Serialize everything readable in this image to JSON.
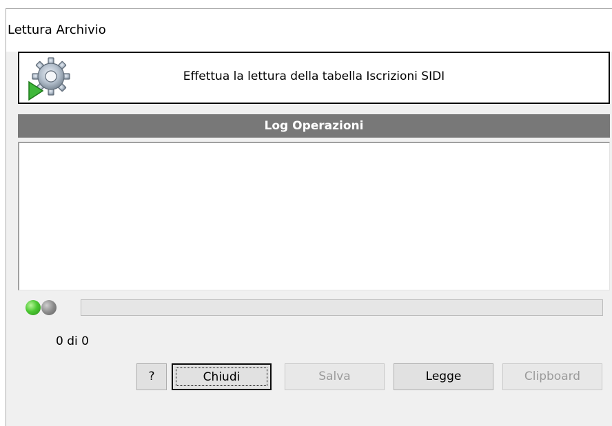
{
  "window": {
    "title": "Lettura Archivio"
  },
  "header": {
    "icon": "gear-play-icon",
    "message": "Effettua la lettura della tabella Iscrizioni SIDI"
  },
  "log": {
    "title": "Log Operazioni",
    "lines": []
  },
  "status": {
    "led1_color": "#4cc832",
    "led2_color": "#8c8c8c",
    "progress_fraction": 0,
    "counter": "0 di 0"
  },
  "buttons": {
    "help": "?",
    "close": "Chiudi",
    "save": "Salva",
    "read": "Legge",
    "clipboard": "Clipboard"
  }
}
